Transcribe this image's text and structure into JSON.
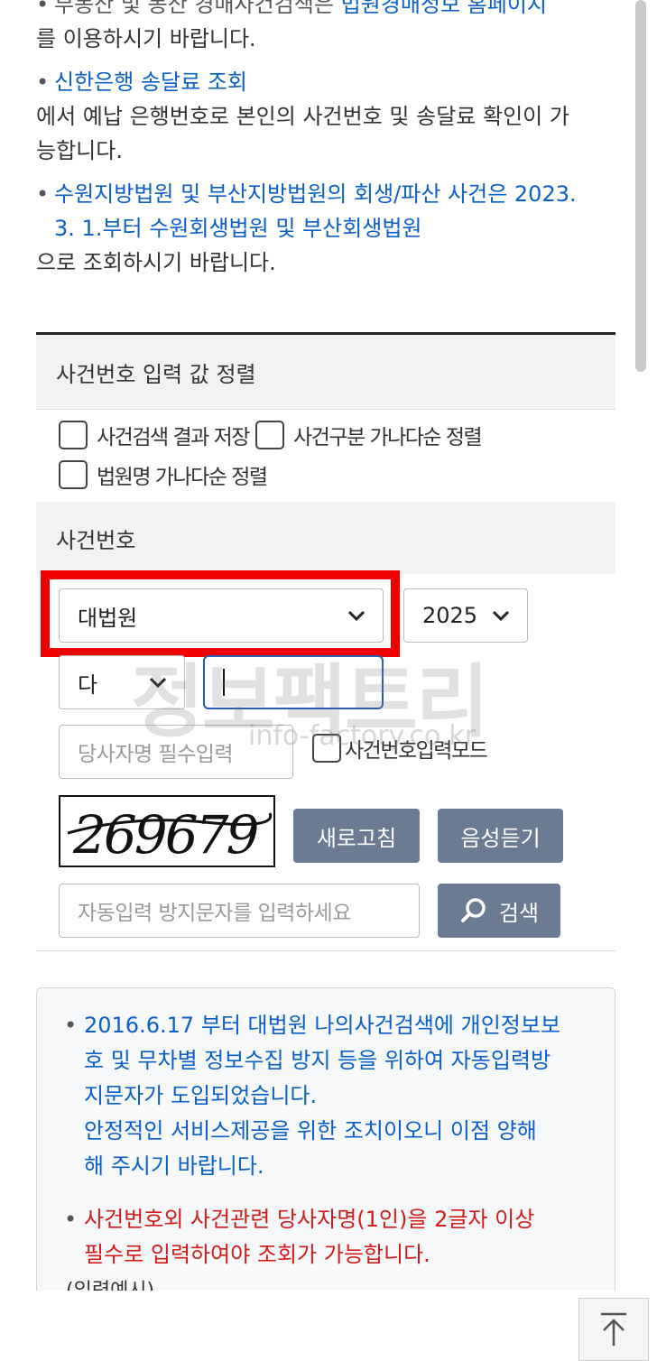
{
  "notes": {
    "item1": {
      "bullet": "•",
      "link": "부동산 및 동산 경매사건검색은",
      "link_tail": "법원경매정보 홈페이지",
      "text": "를 이용하시기 바랍니다."
    },
    "item2": {
      "bullet": "•",
      "link": "신한은행 송달료 조회",
      "text_line1": "에서 예납 은행번호로 본인의 사건번호 및 송달료 확인이 가",
      "text_line2": "능합니다."
    },
    "item3": {
      "bullet": "•",
      "link_line1": "수원지방법원 및 부산지방법원의 회생/파산 사건은 2023.",
      "link_line2": "3. 1.부터 수원회생법원 및 부산회생법원",
      "text": "으로 조회하시기 바랍니다."
    }
  },
  "sort_section": {
    "title": "사건번호 입력 값 정렬",
    "options": [
      {
        "label": "사건검색 결과 저장",
        "checked": false
      },
      {
        "label": "사건구분 가나다순 정렬",
        "checked": false
      },
      {
        "label": "법원명 가나다순 정렬",
        "checked": false
      }
    ]
  },
  "case_section": {
    "title": "사건번호",
    "court_select": "대법원",
    "year_select": "2025",
    "type_select": "다",
    "case_number_value": "",
    "party_placeholder": "당사자명 필수입력",
    "mode_checkbox_label": "사건번호입력모드",
    "captcha_text": "269679",
    "refresh_button": "새로고침",
    "audio_button": "음성듣기",
    "captcha_placeholder": "자동입력 방지문자를 입력하세요",
    "search_button": "검색"
  },
  "watermark": {
    "big": "정보팩트리",
    "small": "info-factory.co.kr"
  },
  "info_box": {
    "item1_lines": [
      "2016.6.17 부터 대법원 나의사건검색에 개인정보보",
      "호 및 무차별 정보수집 방지 등을 위하여 자동입력방",
      "지문자가 도입되었습니다.",
      "안정적인 서비스제공을 위한 조치이오니 이점 양해",
      "해 주시기 바랍니다."
    ],
    "item2_lines": [
      "사건번호외 사건관련 당사자명(1인)을 2글자 이상",
      "필수로 입력하여야 조회가 가능합니다."
    ],
    "partial": "(입력예시)"
  },
  "colors": {
    "link": "#0b5fc7",
    "warning": "#d31b1b",
    "button": "#6b7b93",
    "highlight": "#f00000",
    "focus": "#2a5bb6"
  },
  "icons": {
    "chevron": "chevron-down-icon",
    "search": "search-icon",
    "top": "arrow-up-to-top-icon"
  }
}
